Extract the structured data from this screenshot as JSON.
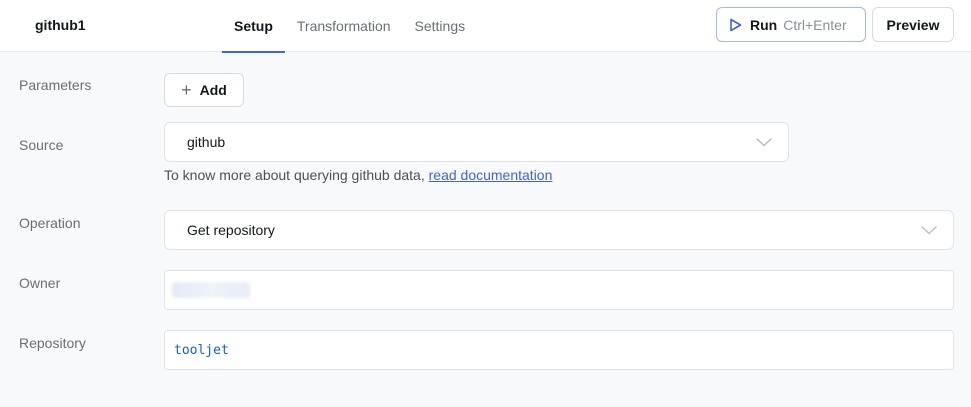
{
  "header": {
    "query_name": "github1",
    "tabs": [
      {
        "label": "Setup",
        "active": true
      },
      {
        "label": "Transformation",
        "active": false
      },
      {
        "label": "Settings",
        "active": false
      }
    ],
    "run_label": "Run",
    "run_shortcut": "Ctrl+Enter",
    "preview_label": "Preview"
  },
  "parameters": {
    "label": "Parameters",
    "add_label": "Add"
  },
  "source": {
    "label": "Source",
    "value": "github",
    "helper_text": "To know more about querying github data, ",
    "helper_link": "read documentation"
  },
  "operation": {
    "label": "Operation",
    "value": "Get repository"
  },
  "owner": {
    "label": "Owner",
    "value_redacted": true
  },
  "repository": {
    "label": "Repository",
    "value": "tooljet"
  },
  "colors": {
    "accent": "#3e63dd",
    "background": "#f8f9fa",
    "text_muted": "#687076"
  }
}
